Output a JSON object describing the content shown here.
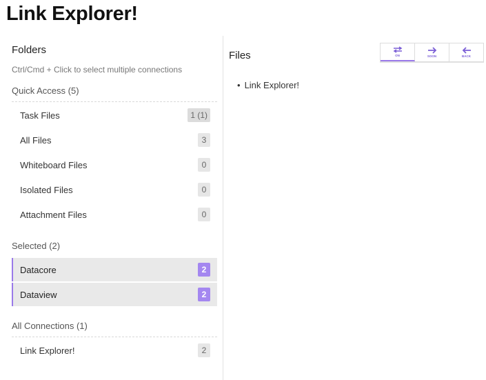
{
  "app": {
    "title": "Link Explorer!"
  },
  "sidebar": {
    "title": "Folders",
    "hint": "Ctrl/Cmd + Click to select multiple connections",
    "quick_access": {
      "heading": "Quick Access (5)",
      "items": [
        {
          "label": "Task Files",
          "count": "1 (1)"
        },
        {
          "label": "All Files",
          "count": "3"
        },
        {
          "label": "Whiteboard Files",
          "count": "0"
        },
        {
          "label": "Isolated Files",
          "count": "0"
        },
        {
          "label": "Attachment Files",
          "count": "0"
        }
      ]
    },
    "selected": {
      "heading": "Selected (2)",
      "items": [
        {
          "label": "Datacore",
          "count": "2"
        },
        {
          "label": "Dataview",
          "count": "2"
        }
      ]
    },
    "all_connections": {
      "heading": "All Connections (1)",
      "items": [
        {
          "label": "Link Explorer!",
          "count": "2"
        }
      ]
    }
  },
  "main": {
    "title": "Files",
    "toolbar": [
      {
        "label": "ON",
        "icon": "arrows-both-icon"
      },
      {
        "label": "SOON",
        "icon": "arrow-right-icon"
      },
      {
        "label": "BACK",
        "icon": "arrow-left-icon"
      }
    ],
    "files": [
      "Link Explorer!"
    ]
  },
  "colors": {
    "accent": "#a487f0",
    "accent_dark": "#7b5fd6"
  }
}
